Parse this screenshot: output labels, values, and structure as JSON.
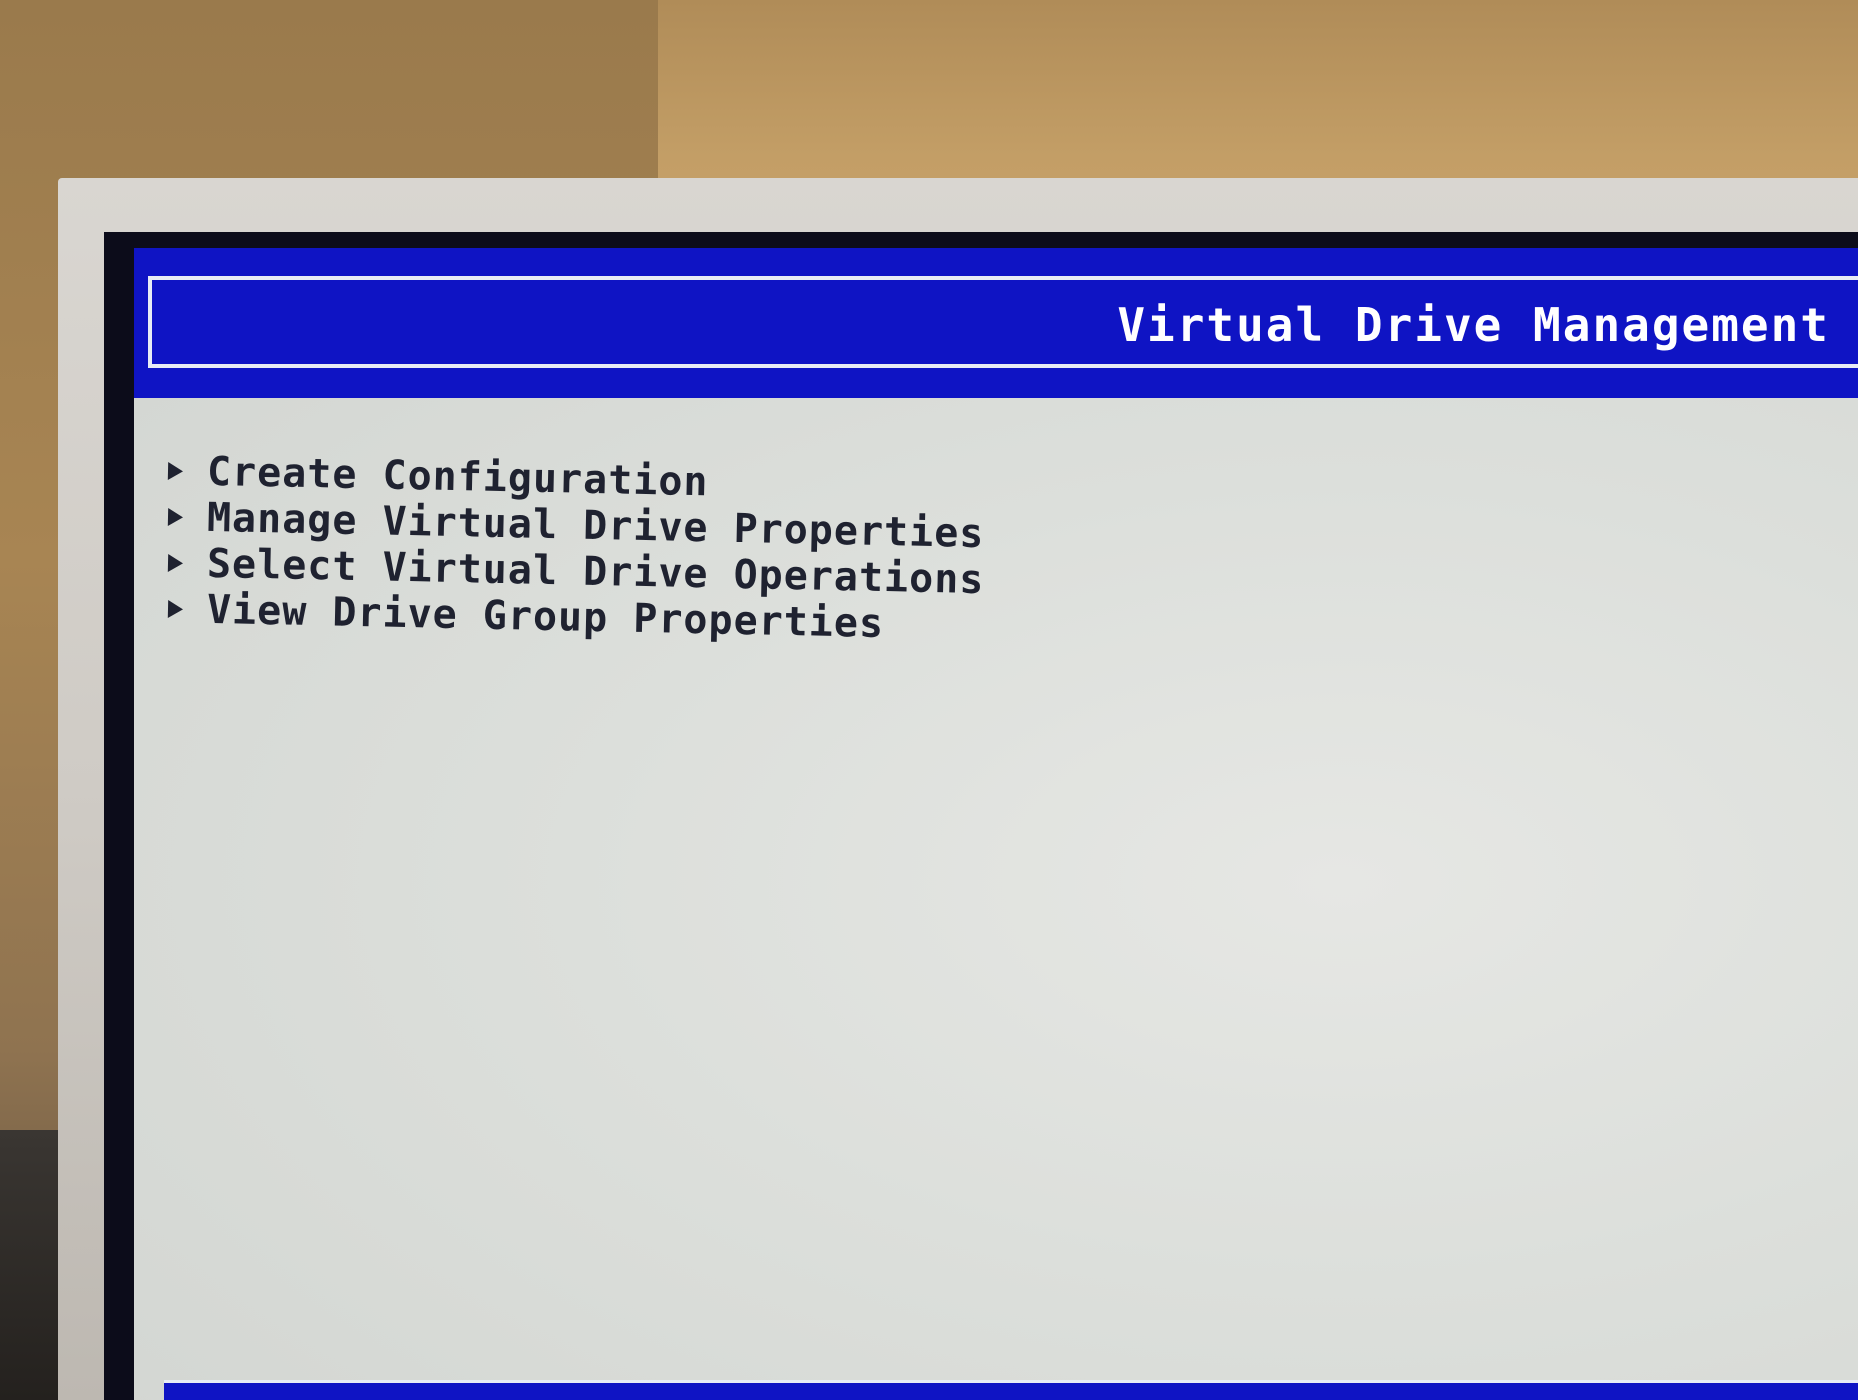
{
  "window": {
    "title": "Virtual Drive Management"
  },
  "menu": {
    "items": [
      {
        "label": "Create Configuration",
        "icon": "triangle-right-icon"
      },
      {
        "label": "Manage Virtual Drive Properties",
        "icon": "triangle-right-icon"
      },
      {
        "label": "Select Virtual Drive Operations",
        "icon": "triangle-right-icon"
      },
      {
        "label": "View Drive Group Properties",
        "icon": "triangle-right-icon"
      }
    ]
  },
  "colors": {
    "title_bar": "#0f14c4",
    "screen_background": "#dcdfdb",
    "title_text": "#ffffff",
    "menu_text": "#1f2230"
  }
}
